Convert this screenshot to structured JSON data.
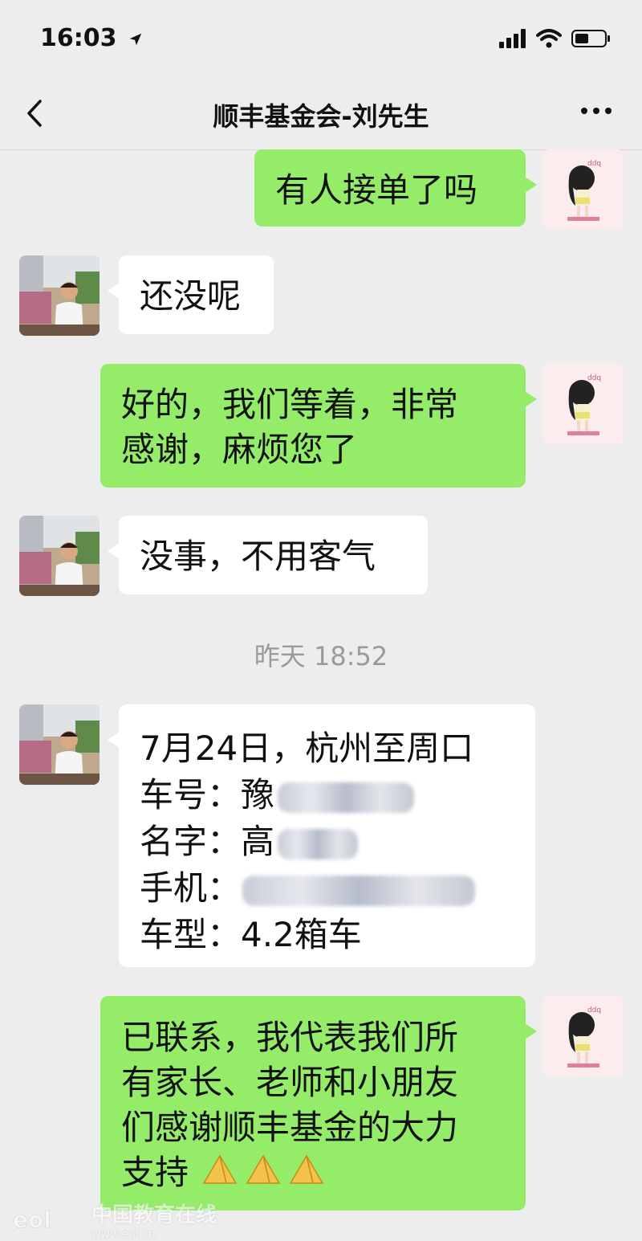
{
  "status_bar": {
    "time": "16:03"
  },
  "header": {
    "title": "顺丰基金会-刘先生"
  },
  "messages": [
    {
      "from": "me",
      "text": "有人接单了吗"
    },
    {
      "from": "other",
      "text": "还没呢"
    },
    {
      "from": "me",
      "lines": [
        "好的，我们等着，非常",
        "感谢，麻烦您了"
      ]
    },
    {
      "from": "other",
      "text": "没事，不用客气"
    },
    {
      "from": "other",
      "lines": [
        "7月24日，杭州至周口",
        "车号：豫",
        "名字：高",
        "手机：",
        "车型：4.2箱车"
      ]
    },
    {
      "from": "me",
      "lines": [
        "已联系，我代表我们所",
        "有家长、老师和小朋友",
        "们感谢顺丰基金的大力",
        "支持"
      ]
    }
  ],
  "timestamp": "昨天 18:52",
  "watermark": {
    "text": "中国教育在线",
    "url": "www.eol.cn",
    "logo": "eol"
  },
  "icons": {
    "location": "location-arrow-icon",
    "signal": "signal-icon",
    "wifi": "wifi-icon",
    "battery": "battery-icon",
    "back": "back-chevron-icon",
    "more": "more-icon",
    "emoji": "folded-hands-emoji"
  },
  "colors": {
    "bg": "#ededed",
    "my_bubble": "#95ec69",
    "their_bubble": "#ffffff",
    "timestamp": "#9a9a9a"
  }
}
